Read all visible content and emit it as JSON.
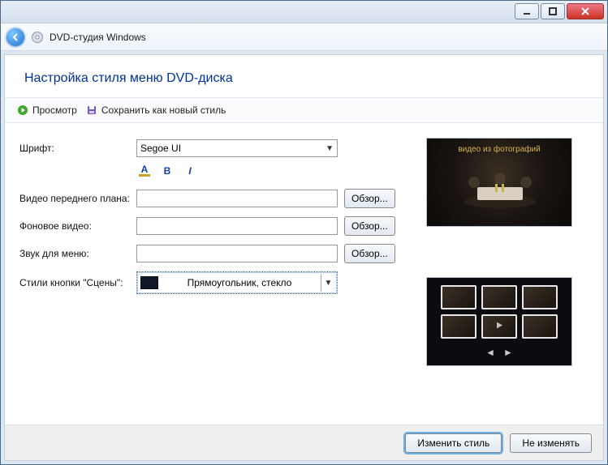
{
  "titlebar": {
    "app_title": "DVD-студия Windows"
  },
  "heading": "Настройка стиля меню DVD-диска",
  "toolbar": {
    "preview_label": "Просмотр",
    "save_style_label": "Сохранить как новый стиль"
  },
  "form": {
    "font_label": "Шрифт:",
    "font_value": "Segoe UI",
    "foreground_video_label": "Видео переднего плана:",
    "foreground_video_value": "",
    "background_video_label": "Фоновое видео:",
    "background_video_value": "",
    "menu_audio_label": "Звук для меню:",
    "menu_audio_value": "",
    "scenes_button_style_label": "Стили кнопки \"Сцены\":",
    "scenes_button_style_value": "Прямоугольник, стекло",
    "browse_label": "Обзор..."
  },
  "preview": {
    "top_caption": "видео из фотографий"
  },
  "footer": {
    "apply_label": "Изменить стиль",
    "cancel_label": "Не изменять"
  },
  "icons": {
    "font_color": "A",
    "bold": "B",
    "italic": "I"
  }
}
